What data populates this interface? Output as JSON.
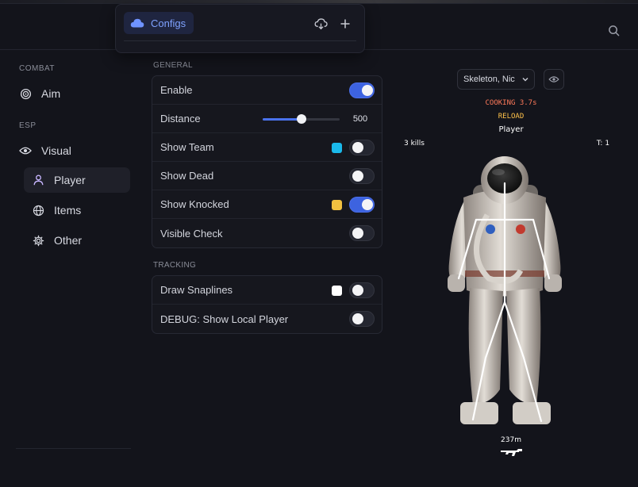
{
  "configs": {
    "tab_label": "Configs"
  },
  "sidebar": {
    "sections": [
      {
        "label": "COMBAT"
      },
      {
        "label": "ESP"
      }
    ],
    "items": {
      "aim": "Aim",
      "visual": "Visual",
      "player": "Player",
      "items": "Items",
      "other": "Other"
    },
    "active": "Player"
  },
  "general": {
    "label": "GENERAL",
    "rows": [
      {
        "label": "Enable",
        "toggle": true
      },
      {
        "label": "Distance",
        "slider_value": "500",
        "slider_fraction": 0.5
      },
      {
        "label": "Show Team",
        "color": "#1ab9ea",
        "toggle": false
      },
      {
        "label": "Show Dead",
        "toggle": false
      },
      {
        "label": "Show Knocked",
        "color": "#f0c040",
        "toggle": true
      },
      {
        "label": "Visible Check",
        "toggle": false
      }
    ]
  },
  "tracking": {
    "label": "TRACKING",
    "rows": [
      {
        "label": "Draw Snaplines",
        "color": "#ffffff",
        "toggle": false
      },
      {
        "label": "DEBUG: Show Local Player",
        "toggle": false
      }
    ]
  },
  "preview": {
    "select_value": "Skeleton, Nic",
    "cooking": "COOKING 3.7s",
    "reload": "RELOAD",
    "name": "Player",
    "kills": "3 kills",
    "team": "T: 1",
    "distance": "237m",
    "colors": {
      "cooking": "#ff7a5a",
      "reload": "#ffc24a",
      "text": "#ffffff"
    }
  },
  "colors": {
    "accent": "#3d63e0",
    "background": "#13141b"
  }
}
